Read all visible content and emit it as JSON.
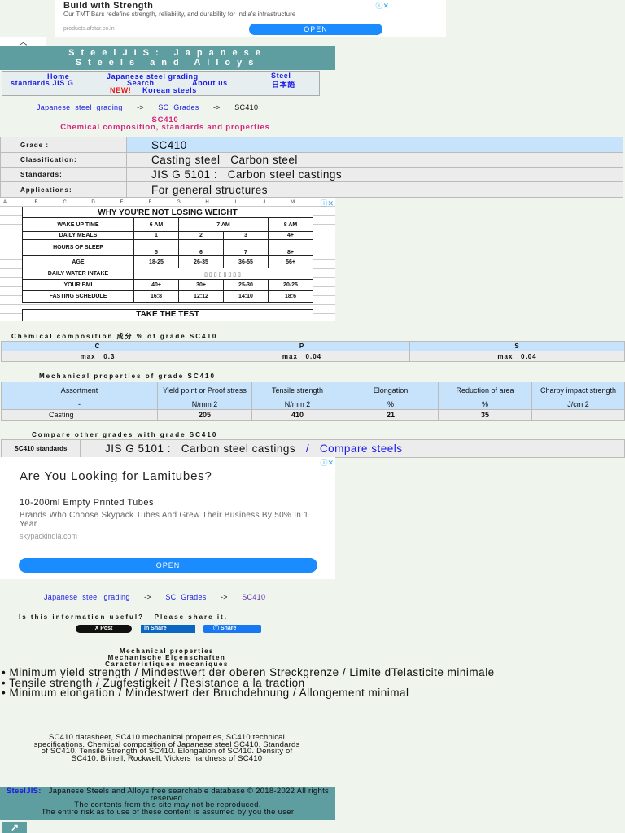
{
  "ad_top": {
    "title": "Build with Strength",
    "body": "Our TMT Bars redefine strength, reliability, and durability for India's infrastructure",
    "url": "products.afstar.co.in",
    "open": "OPEN"
  },
  "header": {
    "line1": "SteelJIS:  Japanese",
    "line2": "Steels and Alloys"
  },
  "nav": {
    "home": "Home",
    "grading": "Japanese steel grading",
    "standards": "Steel standards JIS G",
    "search": "Search",
    "about": "About us",
    "japanese": "日本語",
    "new": "NEW!",
    "korean": "Korean steels"
  },
  "breadcrumb": {
    "grading": "Japanese steel grading",
    "sep": "->",
    "grades": "SC Grades",
    "current": "SC410"
  },
  "title": {
    "grade": "SC410",
    "subtitle": "Chemical composition, standards and properties"
  },
  "info": [
    {
      "label": "Grade :",
      "value": "SC410"
    },
    {
      "label": "Classification:",
      "value": "Casting steel   Carbon steel"
    },
    {
      "label": "Standards:",
      "value": "JIS G 5101 :   Carbon steel castings"
    },
    {
      "label": "Applications:",
      "value": "For general structures"
    }
  ],
  "ad_sheet": {
    "cols": [
      "A",
      "B",
      "C",
      "D",
      "E",
      "F",
      "G",
      "H",
      "I",
      "J",
      "M"
    ],
    "title": "WHY YOU'RE NOT LOSING WEIGHT",
    "rows": [
      [
        "WAKE UP TIME",
        "6 AM",
        "7 AM",
        "8 AM"
      ],
      [
        "DAILY MEALS",
        "1",
        "2",
        "3",
        "4+"
      ],
      [
        "HOURS OF SLEEP",
        "5",
        "6",
        "7",
        "8+"
      ],
      [
        "AGE",
        "18-25",
        "26-35",
        "36-55",
        "56+"
      ],
      [
        "DAILY WATER INTAKE"
      ],
      [
        "YOUR BMI",
        "40+",
        "30+",
        "25-30",
        "20-25"
      ],
      [
        "FASTING SCHEDULE",
        "16:8",
        "12:12",
        "14:10",
        "18:6"
      ]
    ],
    "cta": "TAKE THE TEST"
  },
  "chem": {
    "title": "Chemical composition 成分 % of grade   SC410",
    "headers": [
      "C",
      "P",
      "S"
    ],
    "values": [
      "max   0.3",
      "max   0.04",
      "max   0.04"
    ]
  },
  "mech": {
    "title": "Mechanical properties of grade SC410",
    "headers": [
      "Assortment",
      "Yield point or Proof stress",
      "Tensile strength",
      "Elongation",
      "Reduction of area",
      "Charpy impact strength"
    ],
    "units": [
      "-",
      "N/mm 2",
      "N/mm 2",
      "%",
      "%",
      "J/cm 2"
    ],
    "row": [
      "Casting",
      "205",
      "410",
      "21",
      "35",
      ""
    ]
  },
  "compare": {
    "title": "Compare other grades with grade SC410",
    "label": "SC410 standards",
    "standard": "JIS G 5101 :   Carbon steel castings",
    "slash": "/",
    "link": "Compare steels"
  },
  "ad_mid": {
    "title": "Are You Looking for Lamitubes?",
    "sub": "10-200ml Empty Printed Tubes",
    "body": "Brands Who Choose Skypack Tubes And Grew Their Business By 50% In 1 Year",
    "url": "skypackindia.com",
    "open": "OPEN"
  },
  "share": {
    "question": "Is this information useful?   Please share it.",
    "x": "X Post",
    "linkedin": "Share",
    "facebook": "Share"
  },
  "props": {
    "h1": "Mechanical properties",
    "h2": "Mechanische Eigenschaften",
    "h3": "Caracteristiques mecaniques",
    "b1": "• Minimum yield strength / Mindestwert der oberen Streckgrenze / Limite dTelasticite minimale",
    "b2": "• Tensile strength / Zugfestigkeit / Resistance a la traction",
    "b3": "• Minimum elongation / Mindestwert der Bruchdehnung / Allongement minimal"
  },
  "description": "SC410 datasheet, SC410 mechanical properties, SC410 technical specifications. Chemical composition of Japanese steel SC410. Standards of SC410. Tensile Strength of SC410. Elongation of SC410. Density of SC410. Brinell, Rockwell, Vickers hardness of SC410",
  "footer": {
    "brand": "SteelJIS:",
    "text": "Japanese Steels and Alloys free searchable database   ©  2018-2022   All rights reserved.",
    "line2": "The contents from this site may not be reproduced.",
    "line3": "The entire risk as to use of these content is assumed by you the user"
  },
  "colors": {
    "teal": "#5f9ea0",
    "link": "#1a1ae6",
    "pink": "#d6247f",
    "header_cell": "#c7e2fb"
  }
}
